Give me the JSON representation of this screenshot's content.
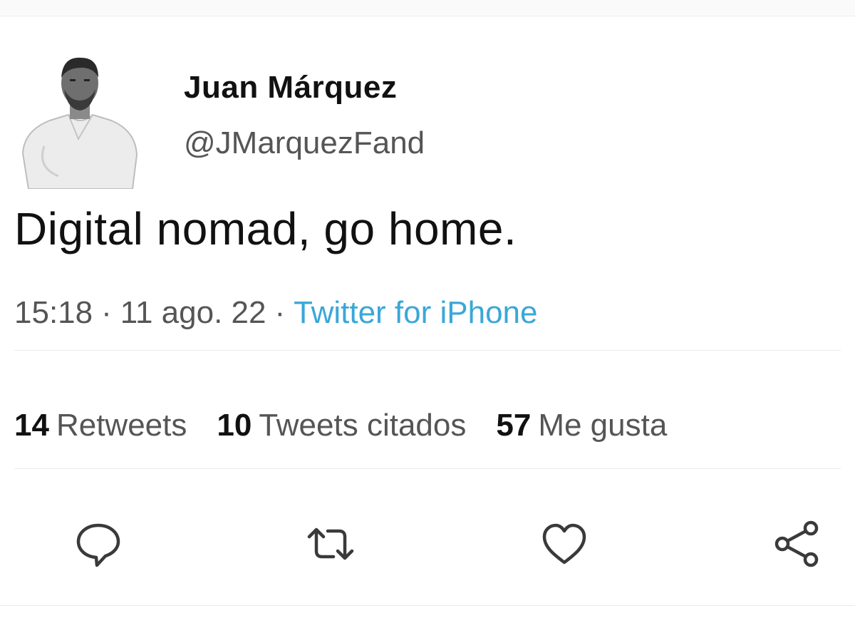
{
  "author": {
    "display_name": "Juan Márquez",
    "handle": "@JMarquezFand"
  },
  "tweet": {
    "text": "Digital nomad, go home.",
    "time": "15:18",
    "date": "11 ago. 22",
    "source": "Twitter for iPhone",
    "separator": "·"
  },
  "stats": {
    "retweets_count": "14",
    "retweets_label": "Retweets",
    "quotes_count": "10",
    "quotes_label": "Tweets citados",
    "likes_count": "57",
    "likes_label": "Me gusta"
  },
  "colors": {
    "source_link": "#3aa7d8",
    "text_primary": "#111111",
    "text_secondary": "#555555"
  },
  "icons": {
    "reply": "speech-bubble-icon",
    "retweet": "retweet-arrows-icon",
    "like": "heart-icon",
    "share": "share-nodes-icon"
  }
}
